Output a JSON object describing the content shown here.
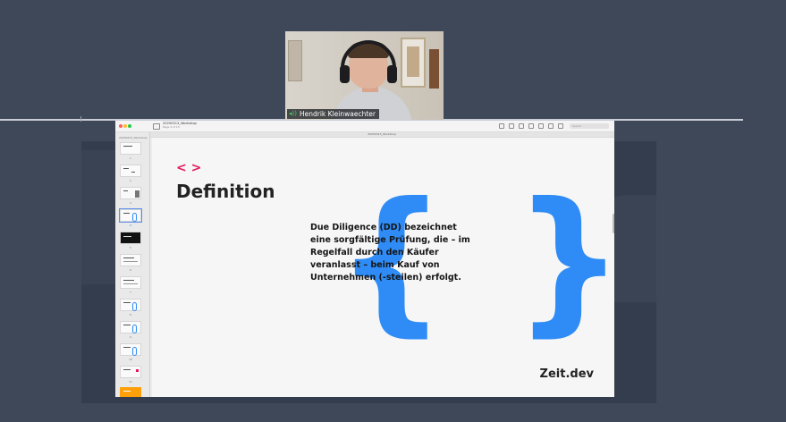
{
  "window": {
    "document_title": "20250313_Workshop",
    "document_subtitle": "Page 4 of 15",
    "tab_label": "20250313_Workshop",
    "search_placeholder": "Search"
  },
  "video": {
    "participant_name": "Hendrik Kleinwaechter",
    "mic_icon": "audio-active-icon"
  },
  "sidebar": {
    "header": "20250313_Workshop",
    "pages": [
      "1",
      "2",
      "3",
      "4",
      "5",
      "6",
      "7",
      "8",
      "9",
      "10",
      "11",
      "12"
    ],
    "selected_page": "4"
  },
  "slide": {
    "icon_text": "< >",
    "title": "Definition",
    "body": "Due Diligence (DD) bezeichnet eine sorgfältige Prüfung, die – im Regelfall durch den Käufer veranlasst – beim Kauf von Unternehmen (-steilen) erfolgt.",
    "brace_left": "{",
    "brace_right": "}",
    "brand": "Zeit.dev"
  },
  "colors": {
    "background": "#3f4859",
    "accent_pink": "#e2185f",
    "accent_blue": "#2f8cf6"
  }
}
